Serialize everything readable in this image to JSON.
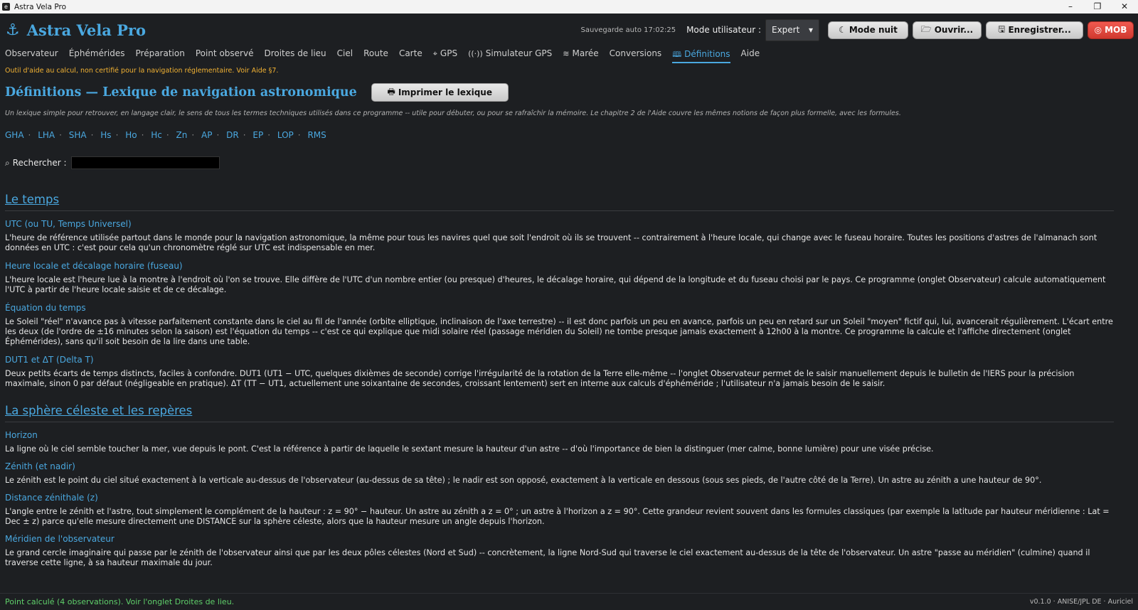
{
  "window": {
    "title": "Astra Vela Pro",
    "icon": "app-icon",
    "controls": [
      "–",
      "❐",
      "✕"
    ]
  },
  "header": {
    "logo_icon": "anchor-icon",
    "logo_text": "Astra Vela Pro",
    "autosave": "Sauvegarde auto 17:02:25",
    "mode_label": "Mode utilisateur :",
    "mode_value": "Expert",
    "buttons": {
      "night": "Mode nuit",
      "open": "Ouvrir...",
      "save": "Enregistrer...",
      "mob": "MOB"
    }
  },
  "nav": [
    {
      "label": "Observateur"
    },
    {
      "label": "Éphémérides"
    },
    {
      "label": "Préparation"
    },
    {
      "label": "Point observé"
    },
    {
      "label": "Droites de lieu"
    },
    {
      "label": "Ciel"
    },
    {
      "label": "Route"
    },
    {
      "label": "Carte"
    },
    {
      "label": "GPS",
      "icon": "crosshair-icon"
    },
    {
      "label": "Simulateur GPS",
      "icon": "antenna-icon"
    },
    {
      "label": "Marée",
      "icon": "wave-icon"
    },
    {
      "label": "Conversions"
    },
    {
      "label": "Définitions",
      "icon": "book-icon",
      "active": true
    },
    {
      "label": "Aide"
    }
  ],
  "warning": "Outil d'aide au calcul, non certifié pour la navigation réglementaire. Voir Aide §7.",
  "page": {
    "title": "Définitions — Lexique de navigation astronomique",
    "print_button": "Imprimer le lexique",
    "intro": "Un lexique simple pour retrouver, en langage clair, le sens de tous les termes techniques utilisés dans ce programme -- utile pour débuter, ou pour se rafraîchir la mémoire. Le chapitre 2 de l'Aide couvre les mêmes notions de façon plus formelle, avec les formules.",
    "quicklinks": [
      "GHA",
      "LHA",
      "SHA",
      "Hs",
      "Ho",
      "Hc",
      "Zn",
      "AP",
      "DR",
      "EP",
      "LOP",
      "RMS"
    ],
    "search_label": "Rechercher :",
    "search_value": ""
  },
  "sections": [
    {
      "title": "Le temps",
      "terms": [
        {
          "name": "UTC (ou TU, Temps Universel)",
          "def": "L'heure de référence utilisée partout dans le monde pour la navigation astronomique, la même pour tous les navires quel que soit l'endroit où ils se trouvent -- contrairement à l'heure locale, qui change avec le fuseau horaire. Toutes les positions d'astres de l'almanach sont données en UTC : c'est pour cela qu'un chronomètre réglé sur UTC est indispensable en mer."
        },
        {
          "name": "Heure locale et décalage horaire (fuseau)",
          "def": "L'heure locale est l'heure lue à la montre à l'endroit où l'on se trouve. Elle diffère de l'UTC d'un nombre entier (ou presque) d'heures, le décalage horaire, qui dépend de la longitude et du fuseau choisi par le pays. Ce programme (onglet Observateur) calcule automatiquement l'UTC à partir de l'heure locale saisie et de ce décalage."
        },
        {
          "name": "Équation du temps",
          "def": "Le Soleil \"réel\" n'avance pas à vitesse parfaitement constante dans le ciel au fil de l'année (orbite elliptique, inclinaison de l'axe terrestre) -- il est donc parfois un peu en avance, parfois un peu en retard sur un Soleil \"moyen\" fictif qui, lui, avancerait régulièrement. L'écart entre les deux (de l'ordre de ±16 minutes selon la saison) est l'équation du temps -- c'est ce qui explique que midi solaire réel (passage méridien du Soleil) ne tombe presque jamais exactement à 12h00 à la montre. Ce programme la calcule et l'affiche directement (onglet Éphémérides), sans qu'il soit besoin de la lire dans une table."
        },
        {
          "name": "DUT1 et ΔT (Delta T)",
          "def": "Deux petits écarts de temps distincts, faciles à confondre. DUT1 (UT1 − UTC, quelques dixièmes de seconde) corrige l'irrégularité de la rotation de la Terre elle-même -- l'onglet Observateur permet de le saisir manuellement depuis le bulletin de l'IERS pour la précision maximale, sinon 0 par défaut (négligeable en pratique). ΔT (TT − UT1, actuellement une soixantaine de secondes, croissant lentement) sert en interne aux calculs d'éphéméride ; l'utilisateur n'a jamais besoin de le saisir."
        }
      ]
    },
    {
      "title": "La sphère céleste et les repères",
      "terms": [
        {
          "name": "Horizon",
          "def": "La ligne où le ciel semble toucher la mer, vue depuis le pont. C'est la référence à partir de laquelle le sextant mesure la hauteur d'un astre -- d'où l'importance de bien la distinguer (mer calme, bonne lumière) pour une visée précise."
        },
        {
          "name": "Zénith (et nadir)",
          "def": "Le zénith est le point du ciel situé exactement à la verticale au-dessus de l'observateur (au-dessus de sa tête) ; le nadir est son opposé, exactement à la verticale en dessous (sous ses pieds, de l'autre côté de la Terre). Un astre au zénith a une hauteur de 90°."
        },
        {
          "name": "Distance zénithale (z)",
          "def": "L'angle entre le zénith et l'astre, tout simplement le complément de la hauteur : z = 90° − hauteur. Un astre au zénith a z = 0° ; un astre à l'horizon a z = 90°. Cette grandeur revient souvent dans les formules classiques (par exemple la latitude par hauteur méridienne : Lat = Dec ± z) parce qu'elle mesure directement une DISTANCE sur la sphère céleste, alors que la hauteur mesure un angle depuis l'horizon."
        },
        {
          "name": "Méridien de l'observateur",
          "def": "Le grand cercle imaginaire qui passe par le zénith de l'observateur ainsi que par les deux pôles célestes (Nord et Sud) -- concrètement, la ligne Nord-Sud qui traverse le ciel exactement au-dessus de la tête de l'observateur. Un astre \"passe au méridien\" (culmine) quand il traverse cette ligne, à sa hauteur maximale du jour."
        }
      ]
    }
  ],
  "status": {
    "left": "Point calculé (4 observations). Voir l'onglet Droites de lieu.",
    "right": "v0.1.0 · ANISE/JPL DE · Auriciel"
  },
  "colors": {
    "accent": "#4aa8e0",
    "warning": "#f2b233",
    "status_ok": "#5fcf6a",
    "mob": "#e0453b",
    "background": "#1d1f22"
  }
}
